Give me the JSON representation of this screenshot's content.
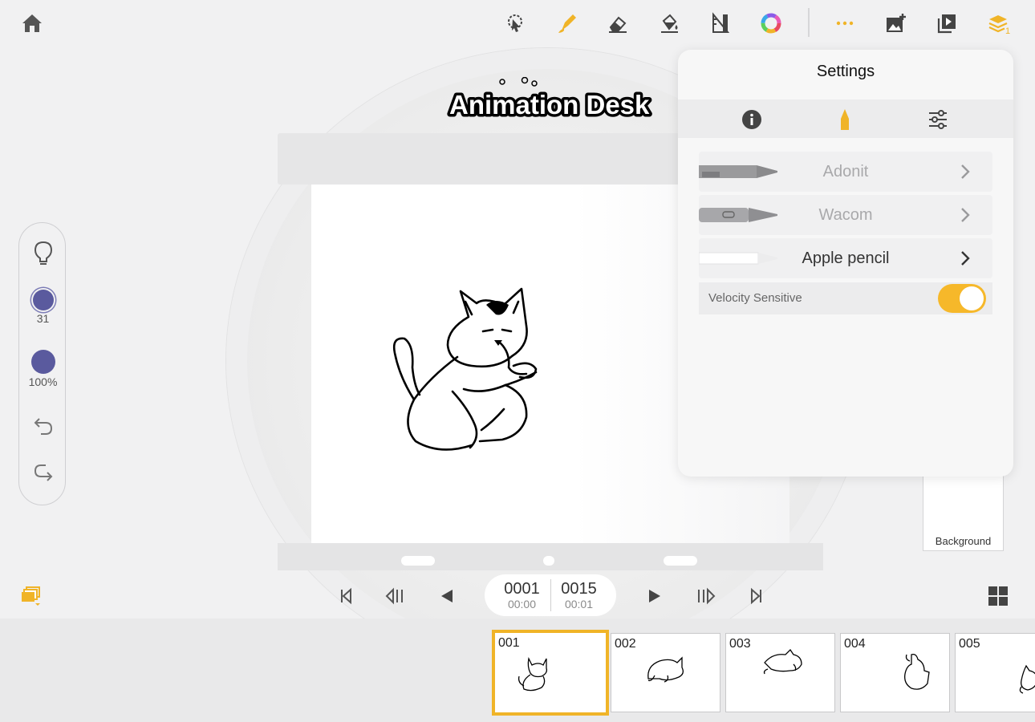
{
  "app": {
    "name": "Animation Desk"
  },
  "toolbar": {
    "items": [
      "home-icon",
      "lasso-icon",
      "brush-icon",
      "eraser-icon",
      "fill-icon",
      "ruler-icon",
      "color-wheel-icon",
      "more-icon",
      "add-image-icon",
      "play-preview-icon",
      "layers-icon"
    ],
    "layers_badge": "1",
    "accent": "#f0b428"
  },
  "left_panel": {
    "brush_size": "31",
    "opacity": "100%",
    "brush_color": "#5a5a9e"
  },
  "settings": {
    "title": "Settings",
    "tabs": [
      "info-icon",
      "pen-icon",
      "sliders-icon"
    ],
    "pens": [
      {
        "name": "Adonit",
        "active": false
      },
      {
        "name": "Wacom",
        "active": false
      },
      {
        "name": "Apple pencil",
        "active": true
      }
    ],
    "velocity_label": "Velocity Sensitive",
    "velocity_on": true
  },
  "playback": {
    "current_frame": "0001",
    "current_time": "00:00",
    "total_frames": "0015",
    "total_time": "00:01"
  },
  "background_card": {
    "label": "Background"
  },
  "timeline": {
    "frames": [
      "001",
      "002",
      "003",
      "004",
      "005"
    ],
    "selected": "001"
  }
}
